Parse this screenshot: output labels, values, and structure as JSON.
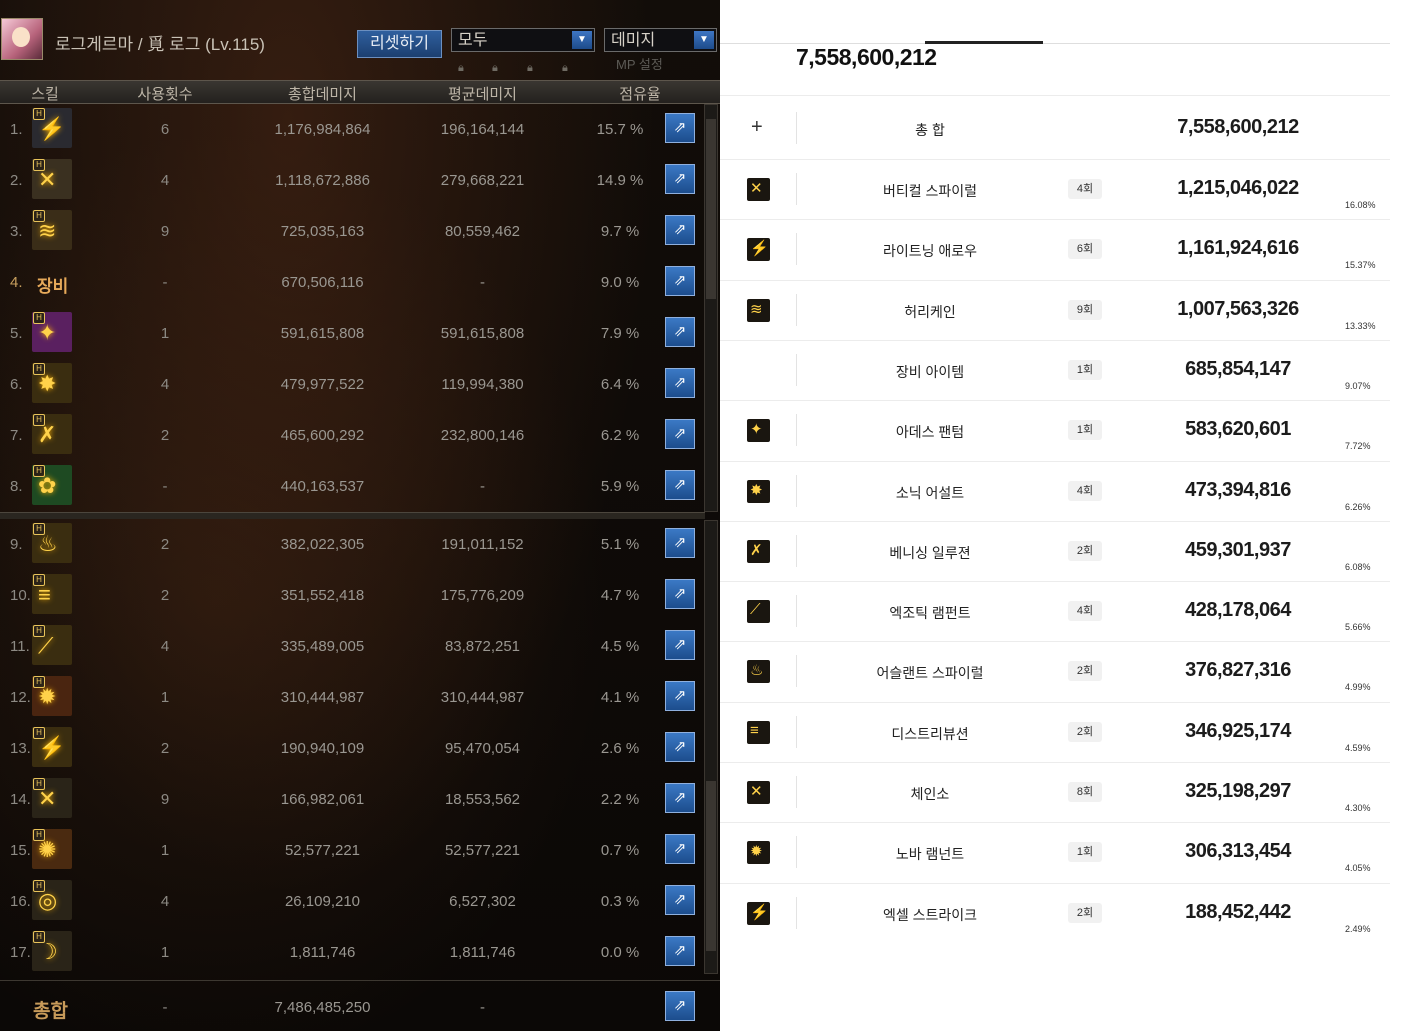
{
  "game": {
    "character": "로그게르마 / 覓 로그 (Lv.115)",
    "reset_button": "리셋하기",
    "filter_select": "모두",
    "metric_select": "데미지",
    "mp_setting": "MP 설정",
    "headers": [
      "스킬",
      "사용횟수",
      "총합데미지",
      "평균데미지",
      "점유율"
    ],
    "rows": [
      {
        "num": "1.",
        "uses": "6",
        "total": "1,176,984,864",
        "avg": "196,164,144",
        "pct": "15.7 %",
        "icon": "lightning-icon",
        "glyph": "⚡",
        "color": "#2a2a30"
      },
      {
        "num": "2.",
        "uses": "4",
        "total": "1,118,672,886",
        "avg": "279,668,221",
        "pct": "14.9 %",
        "icon": "spiral-blade-icon",
        "glyph": "✕",
        "color": "#3a3020"
      },
      {
        "num": "3.",
        "uses": "9",
        "total": "725,035,163",
        "avg": "80,559,462",
        "pct": "9.7 %",
        "icon": "hurricane-icon",
        "glyph": "≋",
        "color": "#3a2d18"
      },
      {
        "num": "4.",
        "label": "장비",
        "uses": "-",
        "total": "670,506,116",
        "avg": "-",
        "pct": "9.0 %"
      },
      {
        "num": "5.",
        "uses": "1",
        "total": "591,615,808",
        "avg": "591,615,808",
        "pct": "7.9 %",
        "icon": "phantom-icon",
        "glyph": "✦",
        "color": "#5a2060"
      },
      {
        "num": "6.",
        "uses": "4",
        "total": "479,977,522",
        "avg": "119,994,380",
        "pct": "6.4 %",
        "icon": "sonic-assault-icon",
        "glyph": "✸",
        "color": "#3a2d10"
      },
      {
        "num": "7.",
        "uses": "2",
        "total": "465,600,292",
        "avg": "232,800,146",
        "pct": "6.2 %",
        "icon": "vanishing-illusion-icon",
        "glyph": "✗",
        "color": "#3a2d10"
      },
      {
        "num": "8.",
        "uses": "-",
        "total": "440,163,537",
        "avg": "-",
        "pct": "5.9 %",
        "icon": "summon-icon",
        "glyph": "✿",
        "color": "#1e4a22"
      },
      {
        "num": "9.",
        "uses": "2",
        "total": "382,022,305",
        "avg": "191,011,152",
        "pct": "5.1 %",
        "icon": "ascendant-spiral-icon",
        "glyph": "♨",
        "color": "#3a2d10"
      },
      {
        "num": "10.",
        "uses": "2",
        "total": "351,552,418",
        "avg": "175,776,209",
        "pct": "4.7 %",
        "icon": "distribution-icon",
        "glyph": "≡",
        "color": "#3a2d10"
      },
      {
        "num": "11.",
        "uses": "4",
        "total": "335,489,005",
        "avg": "83,872,251",
        "pct": "4.5 %",
        "icon": "exotic-rampant-icon",
        "glyph": "⟋",
        "color": "#3a2d10"
      },
      {
        "num": "12.",
        "uses": "1",
        "total": "310,444,987",
        "avg": "310,444,987",
        "pct": "4.1 %",
        "icon": "nova-rampant-icon",
        "glyph": "✹",
        "color": "#4a2510"
      },
      {
        "num": "13.",
        "uses": "2",
        "total": "190,940,109",
        "avg": "95,470,054",
        "pct": "2.6 %",
        "icon": "excel-strike-icon",
        "glyph": "⚡",
        "color": "#3a2d10"
      },
      {
        "num": "14.",
        "uses": "9",
        "total": "166,982,061",
        "avg": "18,553,562",
        "pct": "2.2 %",
        "icon": "chainsaw-icon",
        "glyph": "✕",
        "color": "#2a2418"
      },
      {
        "num": "15.",
        "uses": "1",
        "total": "52,577,221",
        "avg": "52,577,221",
        "pct": "0.7 %",
        "icon": "burst-icon",
        "glyph": "✺",
        "color": "#4a2a10"
      },
      {
        "num": "16.",
        "uses": "4",
        "total": "26,109,210",
        "avg": "6,527,302",
        "pct": "0.3 %",
        "icon": "swirl-icon",
        "glyph": "◎",
        "color": "#2a2418"
      },
      {
        "num": "17.",
        "uses": "1",
        "total": "1,811,746",
        "avg": "1,811,746",
        "pct": "0.0 %",
        "icon": "crescent-icon",
        "glyph": "☽",
        "color": "#2a2418"
      }
    ],
    "total_row": {
      "label": "총합",
      "uses": "-",
      "total": "7,486,485,250",
      "avg": "-"
    },
    "share_icon": "⇗"
  },
  "summary": {
    "headline": "7,558,600,212",
    "total_row": {
      "name": "총 합",
      "value": "7,558,600,212"
    },
    "rows": [
      {
        "name": "버티컬 스파이럴",
        "count": "4회",
        "value": "1,215,046,022",
        "pct": "16.08%",
        "icon": "vertical-spiral-icon",
        "glyph": "✕"
      },
      {
        "name": "라이트닝 애로우",
        "count": "6회",
        "value": "1,161,924,616",
        "pct": "15.37%",
        "icon": "lightning-arrow-icon",
        "glyph": "⚡"
      },
      {
        "name": "허리케인",
        "count": "9회",
        "value": "1,007,563,326",
        "pct": "13.33%",
        "icon": "hurricane-icon",
        "glyph": "≋"
      },
      {
        "name": "장비 아이템",
        "count": "1회",
        "value": "685,854,147",
        "pct": "9.07%"
      },
      {
        "name": "아데스 팬텀",
        "count": "1회",
        "value": "583,620,601",
        "pct": "7.72%",
        "icon": "ades-phantom-icon",
        "glyph": "✦"
      },
      {
        "name": "소닉 어설트",
        "count": "4회",
        "value": "473,394,816",
        "pct": "6.26%",
        "icon": "sonic-assault-icon",
        "glyph": "✸"
      },
      {
        "name": "베니싱 일루젼",
        "count": "2회",
        "value": "459,301,937",
        "pct": "6.08%",
        "icon": "vanishing-illusion-icon",
        "glyph": "✗"
      },
      {
        "name": "엑조틱 램펀트",
        "count": "4회",
        "value": "428,178,064",
        "pct": "5.66%",
        "icon": "exotic-rampant-icon",
        "glyph": "⟋"
      },
      {
        "name": "어슬랜트 스파이럴",
        "count": "2회",
        "value": "376,827,316",
        "pct": "4.99%",
        "icon": "ascendant-spiral-icon",
        "glyph": "♨"
      },
      {
        "name": "디스트리뷰션",
        "count": "2회",
        "value": "346,925,174",
        "pct": "4.59%",
        "icon": "distribution-icon",
        "glyph": "≡"
      },
      {
        "name": "체인소",
        "count": "8회",
        "value": "325,198,297",
        "pct": "4.30%",
        "icon": "chainsaw-icon",
        "glyph": "✕"
      },
      {
        "name": "노바 램넌트",
        "count": "1회",
        "value": "306,313,454",
        "pct": "4.05%",
        "icon": "nova-remnant-icon",
        "glyph": "✹"
      },
      {
        "name": "엑셀 스트라이크",
        "count": "2회",
        "value": "188,452,442",
        "pct": "2.49%",
        "icon": "excel-strike-icon",
        "glyph": "⚡"
      }
    ]
  }
}
